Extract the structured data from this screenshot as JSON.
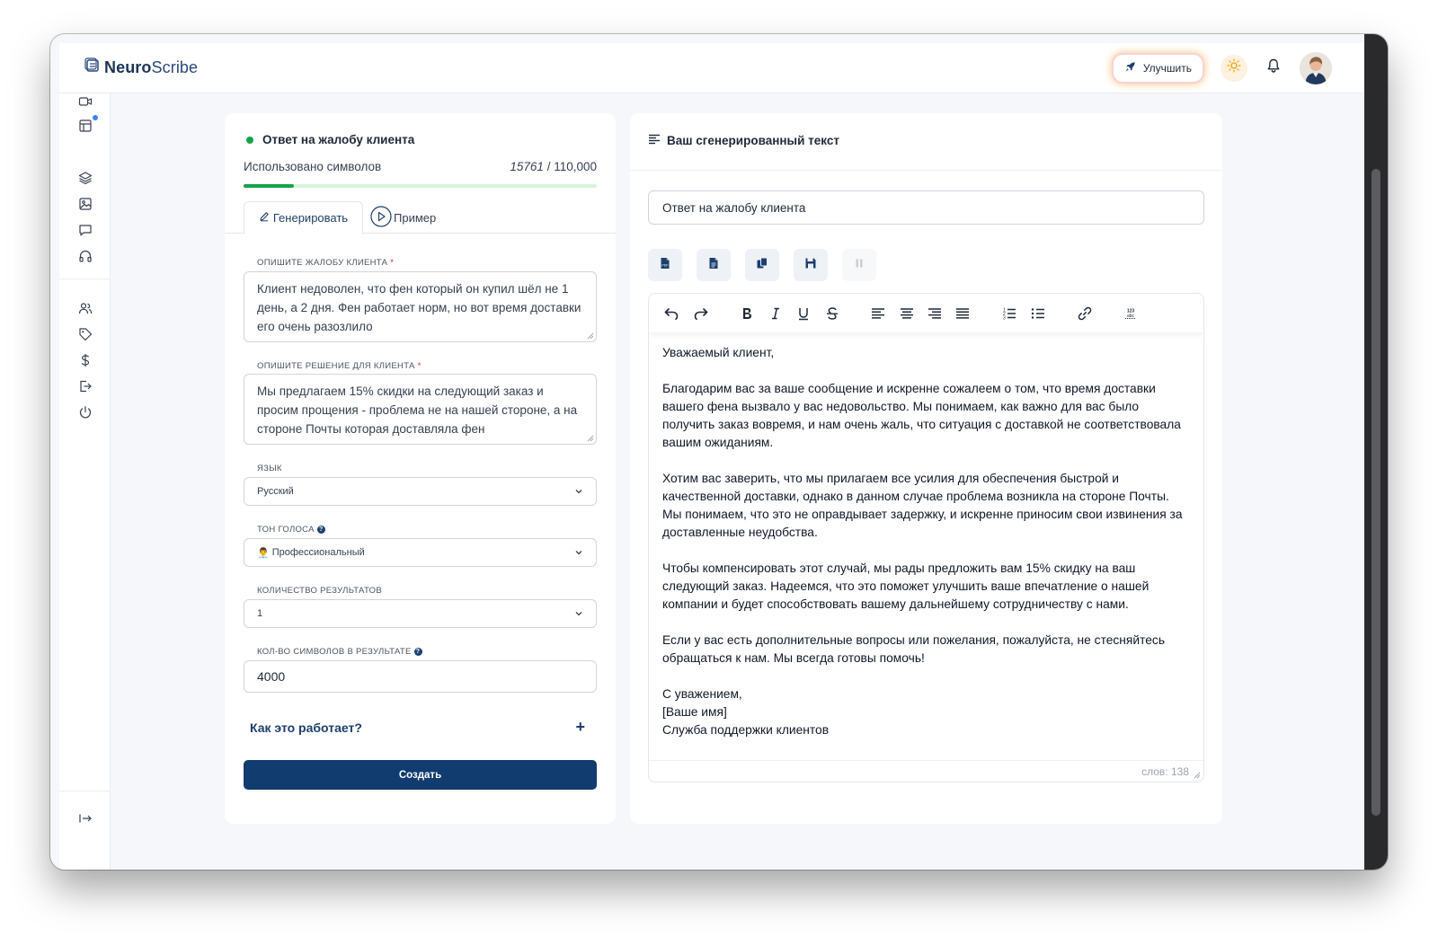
{
  "app": {
    "brand_bold": "Neuro",
    "brand_regular": "Scribe"
  },
  "header": {
    "upgrade_label": "Улучшить"
  },
  "form": {
    "title": "Ответ на жалобу клиента",
    "usage_label": "Использовано символов",
    "usage_used": "15761",
    "usage_total": "/ 110,000",
    "usage_fraction": 0.143,
    "tabs": {
      "generate": "Генерировать",
      "example": "Пример"
    },
    "complaint": {
      "label": "Опишите жалобу клиента",
      "value": "Клиент недоволен, что фен который он купил шёл не 1 день, а 2 дня. Фен работает норм, но вот время доставки его очень разозлило"
    },
    "solution": {
      "label": "Опишите решение для клиента",
      "value": "Мы предлагаем 15% скидки на следующий заказ и просим прощения - проблема не на нашей стороне, а на стороне Почты которая доставляла фен"
    },
    "language": {
      "label": "Язык",
      "value": "Русский"
    },
    "tone": {
      "label": "Тон голоса",
      "emoji": "👨‍💼",
      "value": "Профессиональный"
    },
    "results": {
      "label": "Количество результатов",
      "value": "1"
    },
    "chars": {
      "label": "Кол-во символов в результате",
      "value": "4000"
    },
    "how_label": "Как это работает?",
    "plus": "+",
    "create_label": "Создать"
  },
  "output": {
    "title": "Ваш сгенерированный текст",
    "doc_title": "Ответ на жалобу клиента",
    "paragraphs": [
      "Уважаемый клиент,",
      "Благодарим вас за ваше сообщение и искренне сожалеем о том, что время доставки вашего фена вызвало у вас недовольство. Мы понимаем, как важно для вас было получить заказ вовремя, и нам очень жаль, что ситуация с доставкой не соответствовала вашим ожиданиям.",
      "Хотим вас заверить, что мы прилагаем все усилия для обеспечения быстрой и качественной доставки, однако в данном случае проблема возникла на стороне Почты. Мы понимаем, что это не оправдывает задержку, и искренне приносим свои извинения за доставленные неудобства.",
      "Чтобы компенсировать этот случай, мы рады предложить вам 15% скидку на ваш следующий заказ. Надеемся, что это поможет улучшить ваше впечатление о нашей компании и будет способствовать вашему дальнейшему сотрудничеству с нами.",
      "Если у вас есть дополнительные вопросы или пожелания, пожалуйста, не стесняйтесь обращаться к нам. Мы всегда готовы помочь!"
    ],
    "signature": [
      "С уважением,",
      "[Ваше имя]",
      "Служба поддержки клиентов"
    ],
    "word_count": "слов: 138"
  },
  "colors": {
    "primary": "#103c70",
    "accent_green": "#16a34a",
    "notify_dot": "#3b82f6"
  },
  "icons": {
    "sidebar": [
      "video-icon",
      "layout-icon",
      "layers-icon",
      "image-icon",
      "chat-icon",
      "headphones-icon",
      "users-icon",
      "tag-icon",
      "dollar-icon",
      "logout-icon",
      "power-icon",
      "expand-sidebar-icon"
    ],
    "actions": [
      "export-pdf-icon",
      "export-doc-icon",
      "copy-icon",
      "save-icon",
      "pause-icon"
    ],
    "toolbar": [
      "undo-icon",
      "redo-icon",
      "bold-icon",
      "italic-icon",
      "underline-icon",
      "strikethrough-icon",
      "align-left-icon",
      "align-center-icon",
      "align-right-icon",
      "align-justify-icon",
      "ordered-list-icon",
      "bullet-list-icon",
      "link-icon",
      "spellcheck-icon"
    ]
  }
}
